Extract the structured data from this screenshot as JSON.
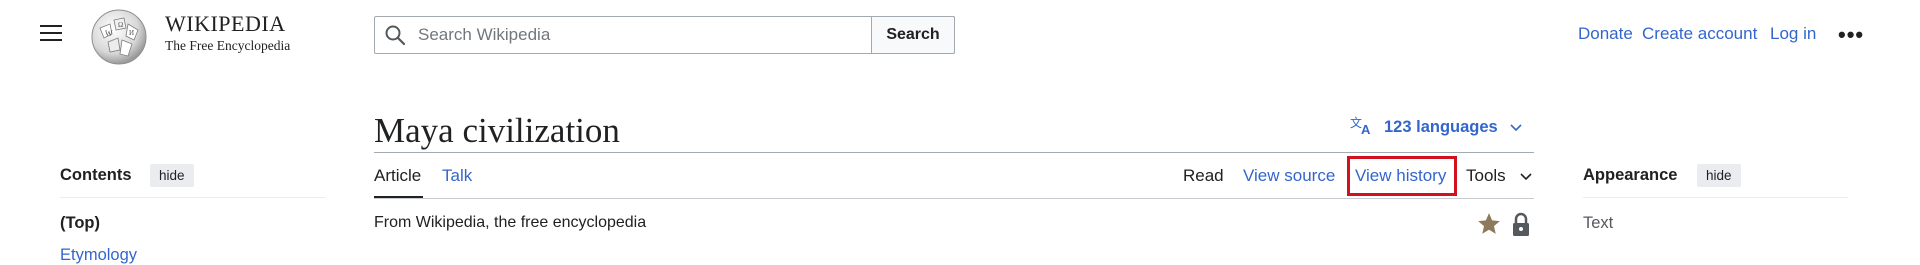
{
  "header": {
    "wordmark_title": "WIKIPEDIA",
    "wordmark_tagline": "The Free Encyclopedia",
    "search_placeholder": "Search Wikipedia",
    "search_button": "Search",
    "links": {
      "donate": "Donate",
      "create_account": "Create account",
      "log_in": "Log in"
    },
    "more_label": "•••"
  },
  "page": {
    "title": "Maya civilization",
    "languages": "123 languages",
    "tagline": "From Wikipedia, the free encyclopedia"
  },
  "tabs": {
    "article": "Article",
    "talk": "Talk",
    "read": "Read",
    "view_source": "View source",
    "view_history": "View history",
    "tools": "Tools"
  },
  "toc": {
    "title": "Contents",
    "hide": "hide",
    "items": [
      "(Top)",
      "Etymology"
    ]
  },
  "appearance": {
    "title": "Appearance",
    "hide": "hide",
    "text_label": "Text"
  },
  "colors": {
    "link": "#3366cc",
    "highlight_box": "#d3111e",
    "text": "#202122"
  },
  "icons": [
    "menu-icon",
    "wikipedia-globe-logo",
    "search-icon",
    "translate-icon",
    "chevron-down-icon",
    "star-icon",
    "lock-icon"
  ]
}
